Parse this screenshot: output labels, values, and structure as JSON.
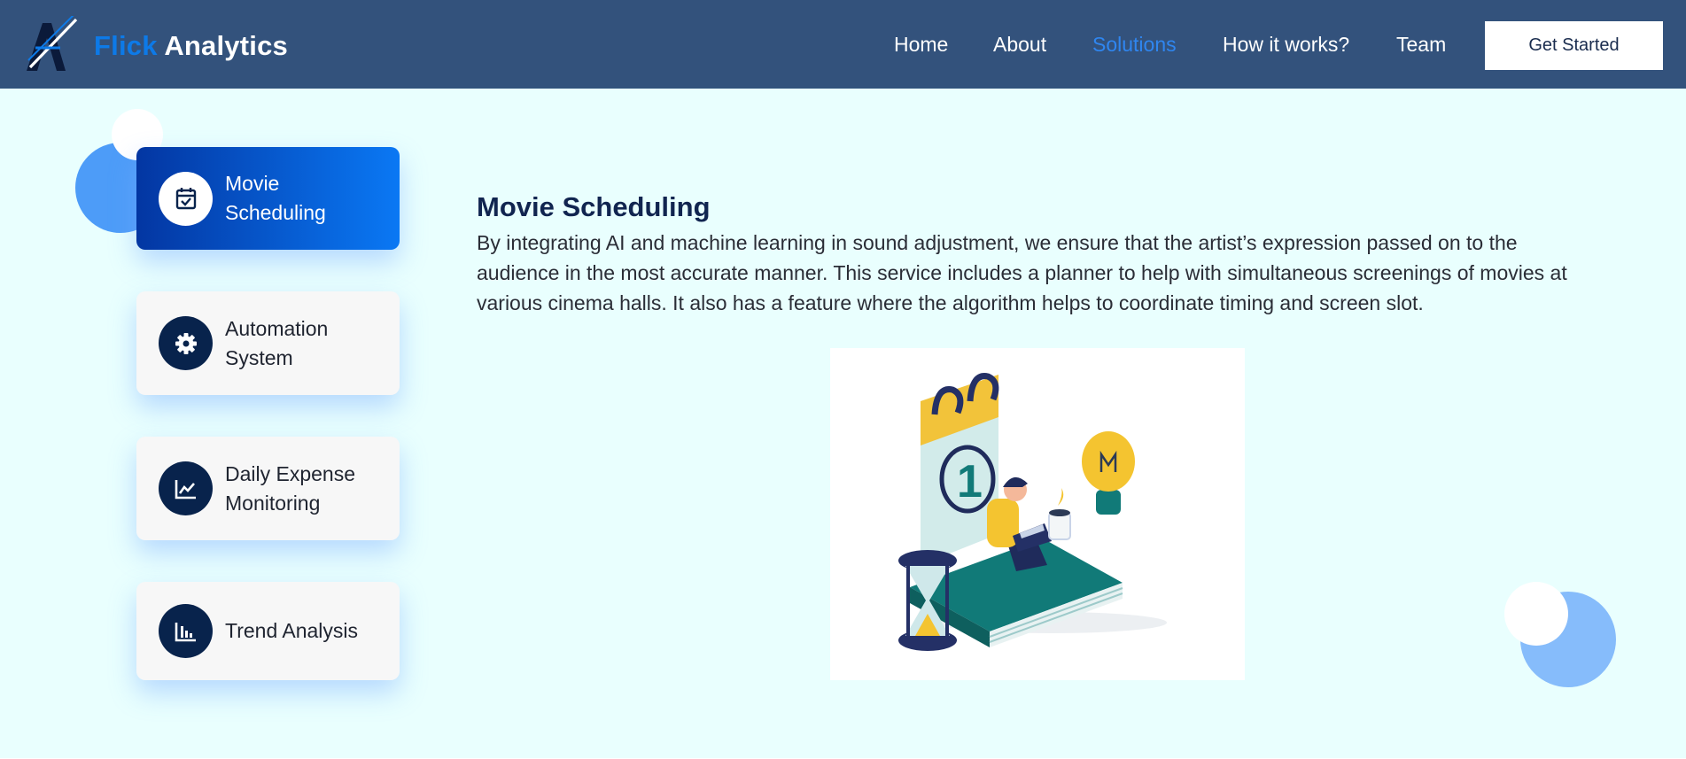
{
  "brand": {
    "part1": "Flick",
    "part2": "Analytics"
  },
  "nav": {
    "links": [
      "Home",
      "About",
      "Solutions",
      "How it works?",
      "Team"
    ],
    "active": "Solutions",
    "cta": "Get Started"
  },
  "services": [
    {
      "label": "Movie Scheduling",
      "icon": "calendar-check-icon",
      "active": true
    },
    {
      "label": "Automation System",
      "icon": "gear-icon",
      "active": false
    },
    {
      "label": "Daily Expense Monitoring",
      "icon": "line-chart-icon",
      "active": false
    },
    {
      "label": "Trend Analysis",
      "icon": "bar-chart-icon",
      "active": false
    }
  ],
  "content": {
    "title": "Movie Scheduling",
    "description": "By integrating AI and machine learning in sound adjustment, we ensure that the artist’s expression passed on to the audience in the most accurate manner. This service includes a planner to help with simultaneous screenings of movies at various cinema halls. It also has a feature where the algorithm helps to coordinate timing and screen slot."
  },
  "colors": {
    "navbar": "#33527c",
    "background": "#e9fffe",
    "accent": "#0d7ae8",
    "active_gradient_start": "#0336a2",
    "active_gradient_end": "#0a78f4",
    "icon_circle": "#08234c"
  }
}
